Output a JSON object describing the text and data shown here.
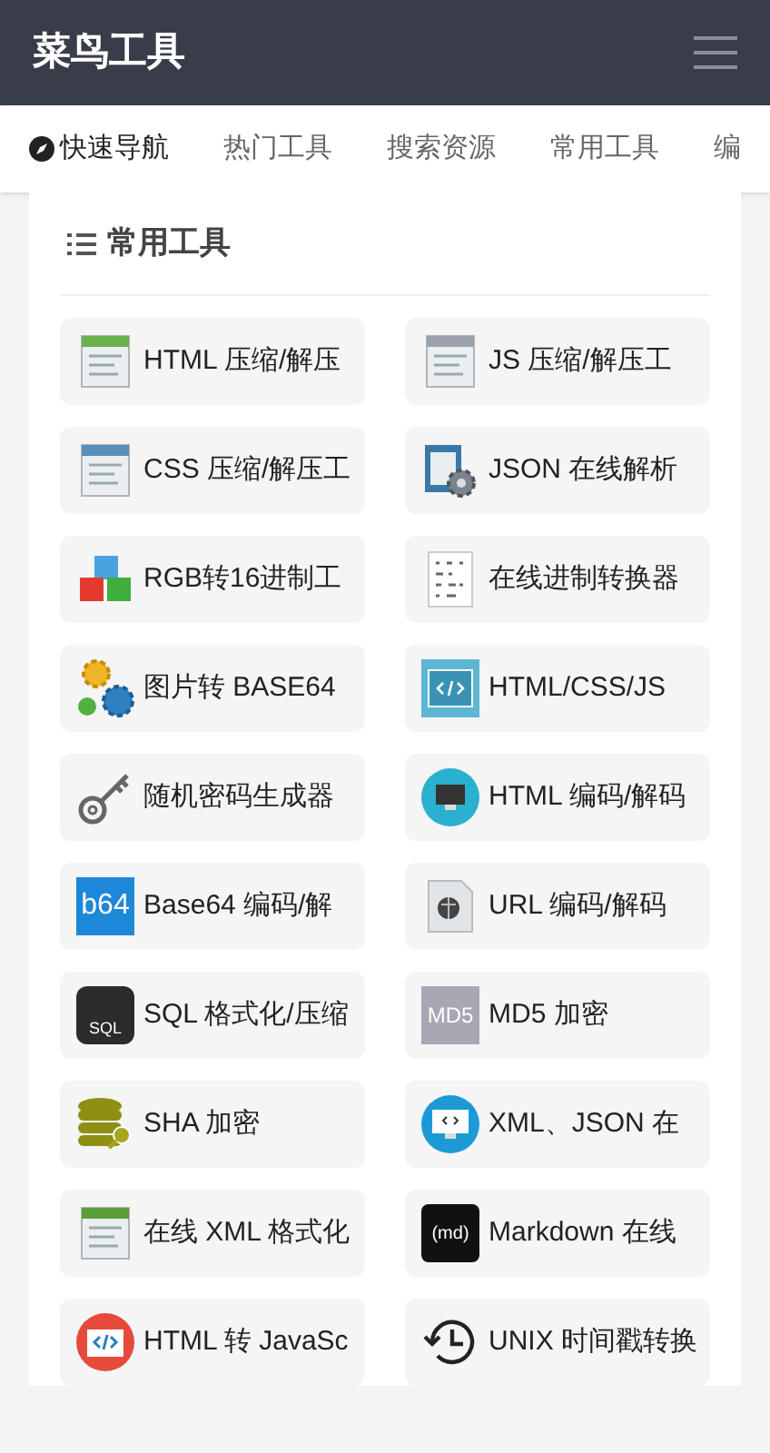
{
  "header": {
    "title": "菜鸟工具"
  },
  "nav": [
    {
      "label": "快速导航",
      "selected": true
    },
    {
      "label": "热门工具",
      "selected": false
    },
    {
      "label": "搜索资源",
      "selected": false
    },
    {
      "label": "常用工具",
      "selected": false
    },
    {
      "label": "编",
      "selected": false
    }
  ],
  "section": {
    "title": "常用工具"
  },
  "tools": [
    {
      "label": "HTML 压缩/解压"
    },
    {
      "label": "JS 压缩/解压工"
    },
    {
      "label": "CSS 压缩/解压工"
    },
    {
      "label": "JSON 在线解析"
    },
    {
      "label": "RGB转16进制工"
    },
    {
      "label": "在线进制转换器"
    },
    {
      "label": "图片转 BASE64"
    },
    {
      "label": "HTML/CSS/JS"
    },
    {
      "label": "随机密码生成器"
    },
    {
      "label": "HTML 编码/解码"
    },
    {
      "label": "Base64 编码/解",
      "icon_text": "b64"
    },
    {
      "label": "URL 编码/解码"
    },
    {
      "label": "SQL 格式化/压缩",
      "icon_text": "SQL"
    },
    {
      "label": "MD5 加密",
      "icon_text": "MD5"
    },
    {
      "label": "SHA 加密"
    },
    {
      "label": "XML、JSON 在"
    },
    {
      "label": "在线 XML 格式化"
    },
    {
      "label": "Markdown 在线",
      "icon_text": "(md)"
    },
    {
      "label": "HTML 转 JavaSc"
    },
    {
      "label": "UNIX 时间戳转换"
    }
  ]
}
